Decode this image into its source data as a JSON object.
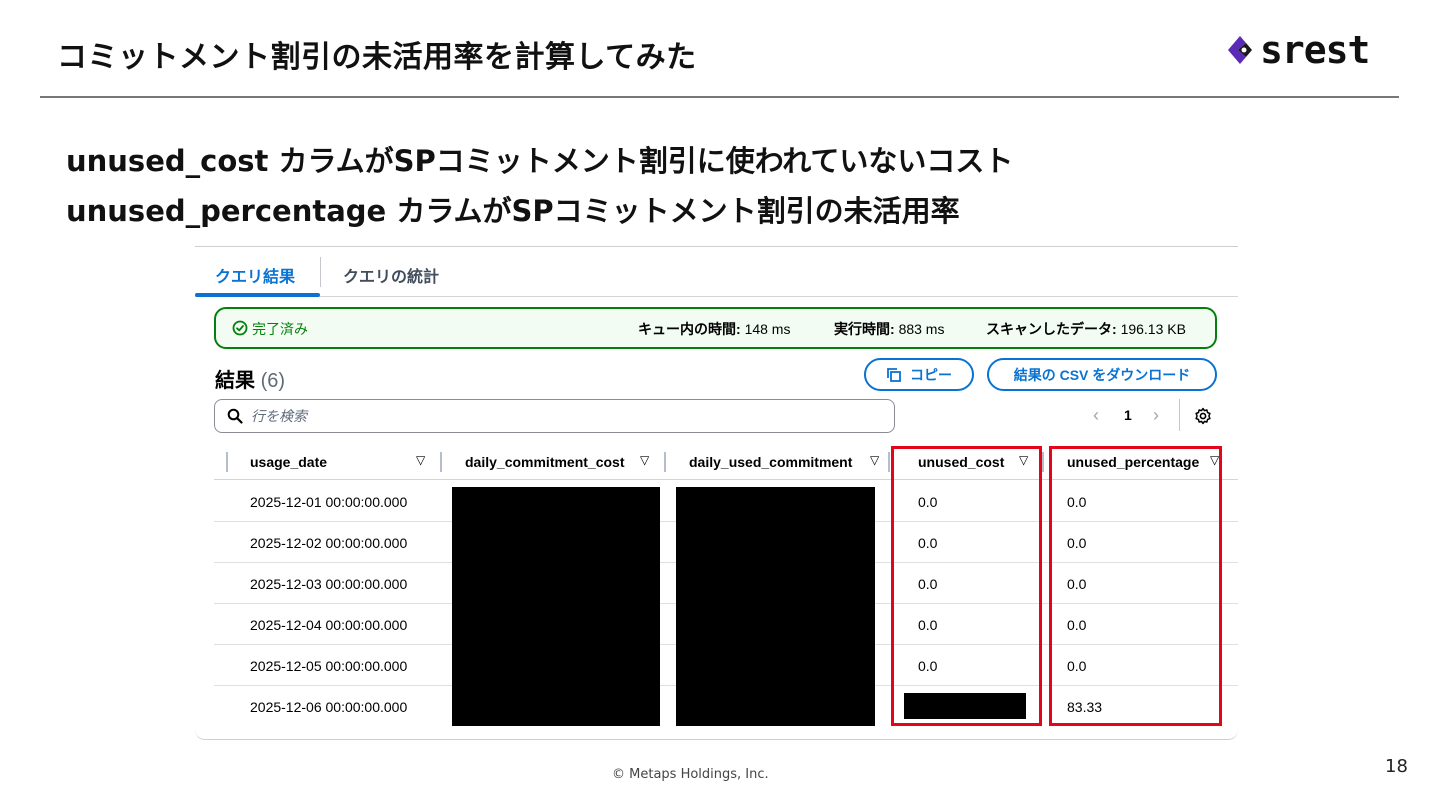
{
  "slide": {
    "title": "コミットメント割引の未活用率を計算してみた",
    "logo_text": "srest",
    "description_lines": [
      "unused_cost カラムがSPコミットメント割引に使われていないコスト",
      "unused_percentage カラムがSPコミットメント割引の未活用率"
    ],
    "footer": "© Metaps Holdings,  Inc.",
    "page_number": "18"
  },
  "console": {
    "tabs": [
      {
        "label": "クエリ結果",
        "active": true
      },
      {
        "label": "クエリの統計",
        "active": false
      }
    ],
    "status": {
      "label": "完了済み",
      "queue_time_label": "キュー内の時間:",
      "queue_time_value": "148 ms",
      "run_time_label": "実行時間:",
      "run_time_value": "883 ms",
      "scanned_label": "スキャンしたデータ:",
      "scanned_value": "196.13 KB"
    },
    "results": {
      "title": "結果",
      "count": "(6)",
      "copy_label": "コピー",
      "download_label": "結果の CSV をダウンロード"
    },
    "search": {
      "placeholder": "行を検索"
    },
    "pagination": {
      "prev": "‹",
      "page": "1",
      "next": "›"
    },
    "table": {
      "columns": [
        "usage_date",
        "daily_commitment_cost",
        "daily_used_commitment",
        "unused_cost",
        "unused_percentage"
      ],
      "rows": [
        {
          "usage_date": "2025-12-01 00:00:00.000",
          "unused_cost": "0.0",
          "unused_percentage": "0.0"
        },
        {
          "usage_date": "2025-12-02 00:00:00.000",
          "unused_cost": "0.0",
          "unused_percentage": "0.0"
        },
        {
          "usage_date": "2025-12-03 00:00:00.000",
          "unused_cost": "0.0",
          "unused_percentage": "0.0"
        },
        {
          "usage_date": "2025-12-04 00:00:00.000",
          "unused_cost": "0.0",
          "unused_percentage": "0.0"
        },
        {
          "usage_date": "2025-12-05 00:00:00.000",
          "unused_cost": "0.0",
          "unused_percentage": "0.0"
        },
        {
          "usage_date": "2025-12-06 00:00:00.000",
          "unused_cost": "",
          "unused_percentage": "83.33"
        }
      ]
    }
  },
  "colors": {
    "accent_blue": "#0972d3",
    "success_green": "#037f0c",
    "highlight_red": "#e3051b",
    "logo_purple": "#5b2bb6"
  },
  "icons": [
    "srest-logo-mark",
    "check-circle-icon",
    "copy-icon",
    "search-icon",
    "chevron-left-icon",
    "chevron-right-icon",
    "gear-icon",
    "sort-caret-icon"
  ]
}
